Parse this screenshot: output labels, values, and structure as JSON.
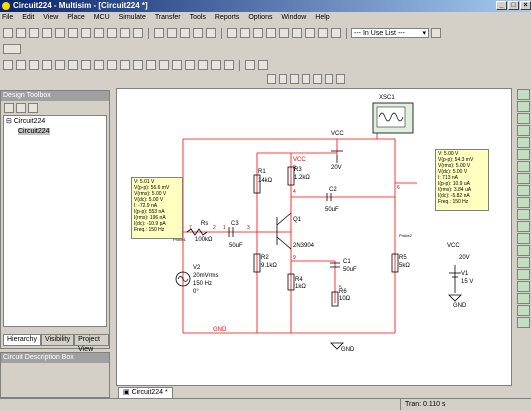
{
  "window": {
    "title": "Circuit224 - Multisim - [Circuit224 *]"
  },
  "menu": [
    "File",
    "Edit",
    "View",
    "Place",
    "MCU",
    "Simulate",
    "Transfer",
    "Tools",
    "Reports",
    "Options",
    "Window",
    "Help"
  ],
  "toolbar": {
    "in_use_list": "--- In Use List ---"
  },
  "design_toolbox": {
    "title": "Design Toolbox",
    "tree": {
      "root": "Circuit224",
      "child": "Circuit224"
    },
    "tabs": [
      "Hierarchy",
      "Visibility",
      "Project View"
    ]
  },
  "circuit_description": {
    "title": "Circuit Description Box"
  },
  "document_tab": "Circuit224 *",
  "status": {
    "tran": "Tran: 0.110 s"
  },
  "schematic": {
    "labels": {
      "vcc_top": "VCC",
      "vcc_20v": "20V",
      "xsc1": "XSC1",
      "vcc_red": "VCC",
      "r1": "R1",
      "r1v": "14kΩ",
      "r3": "R3",
      "r3v": "1.2kΩ",
      "r2": "R2",
      "r2v": "9.1kΩ",
      "r4": "R4",
      "r4v": "1kΩ",
      "rs": "Rs",
      "rsv": "100kΩ",
      "c3": "C3",
      "c3v": "50uF",
      "c2": "C2",
      "c2v": "50uF",
      "c1": "C1",
      "c1v": "50uF",
      "r6": "R6",
      "r6v": "10Ω",
      "r5": "R5",
      "r5v": "5kΩ",
      "q1": "Q1",
      "q1v": "2N3904",
      "v2": "V2",
      "v2a": "20mVrms",
      "v2b": "150 Hz",
      "v2c": "0°",
      "gnd1": "GND",
      "gnd2": "GND",
      "gnd3": "GND",
      "vcc_r": "VCC",
      "vcc_r20": "20V",
      "v1": "V1",
      "v1v": "15 V",
      "probe1": "Probe1",
      "probe2": "Probe2",
      "n1": "1",
      "n2": "2",
      "n3": "3",
      "n4": "4",
      "n6": "6",
      "n7": "7",
      "n8": "8",
      "n9": "9",
      "n5": "5"
    },
    "probe_left": [
      "V: 5.01 V",
      "V(p-p): 56.6 mV",
      "V(rms): 5.00 V",
      "V(dc): 5.00 V",
      "I: -72.9 nA",
      "I(p-p): 553 nA",
      "I(rms): 196 nA",
      "I(dc): -10.9 pA",
      "Freq.: 150 Hz"
    ],
    "probe_right": [
      "V: 5.00 V",
      "V(p-p): 54.3 mV",
      "V(rms): 5.00 V",
      "V(dc): 5.00 V",
      "I: 713 nA",
      "I(p-p): 10.9 uA",
      "I(rms): 3.84 uA",
      "I(dc): -5.82 nA",
      "Freq.: 150 Hz"
    ]
  },
  "colors": {
    "wire": "#ff0000",
    "label": "#000000",
    "node": "#cc0000",
    "probe_bg": "#ffffc0"
  }
}
